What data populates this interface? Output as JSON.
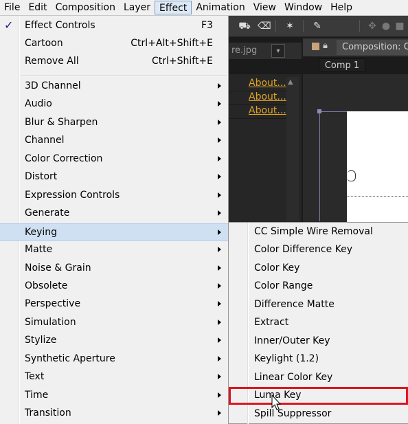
{
  "menubar": {
    "items": [
      "File",
      "Edit",
      "Composition",
      "Layer",
      "Effect",
      "Animation",
      "View",
      "Window",
      "Help"
    ],
    "active_index": 4
  },
  "project_panel": {
    "tab_text": "re.jpg",
    "about_links": [
      "About...",
      "About...",
      "About..."
    ]
  },
  "composition_panel": {
    "title": "Composition: C",
    "tab": "Comp 1"
  },
  "effect_menu": {
    "top_items": [
      {
        "label": "Effect Controls",
        "shortcut": "F3",
        "checked": true
      },
      {
        "label": "Cartoon",
        "shortcut": "Ctrl+Alt+Shift+E"
      },
      {
        "label": "Remove All",
        "shortcut": "Ctrl+Shift+E"
      }
    ],
    "categories": [
      "3D Channel",
      "Audio",
      "Blur & Sharpen",
      "Channel",
      "Color Correction",
      "Distort",
      "Expression Controls",
      "Generate",
      "Keying",
      "Matte",
      "Noise & Grain",
      "Obsolete",
      "Perspective",
      "Simulation",
      "Stylize",
      "Synthetic Aperture",
      "Text",
      "Time",
      "Transition"
    ],
    "highlighted_category": "Keying"
  },
  "keying_submenu": {
    "items": [
      "CC Simple Wire Removal",
      "Color Difference Key",
      "Color Key",
      "Color Range",
      "Difference Matte",
      "Extract",
      "Inner/Outer Key",
      "Keylight (1.2)",
      "Linear Color Key",
      "Luma Key",
      "Spill Suppressor"
    ],
    "selected": "Luma Key"
  },
  "colors": {
    "menu_bg": "#f0f0f0",
    "highlight": "#cfe0f3",
    "selection_outline": "#e0151f",
    "link": "#e0a424"
  },
  "icons": [
    "checkmark-icon",
    "submenu-arrow-icon",
    "lock-icon",
    "mouse-cursor-icon"
  ]
}
